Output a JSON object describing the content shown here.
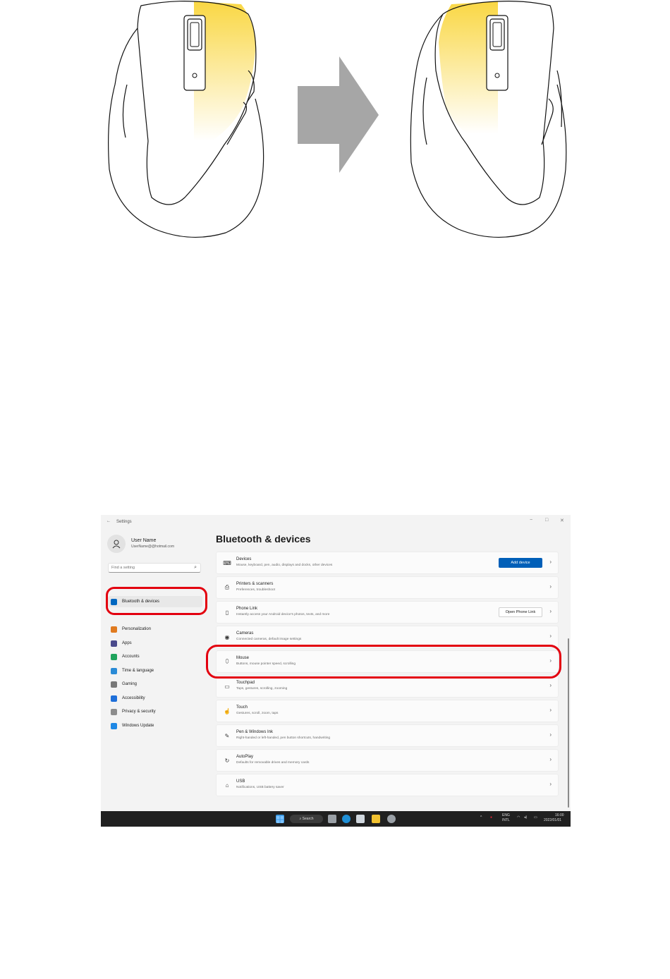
{
  "window": {
    "back_glyph": "←",
    "title": "Settings",
    "minimize_glyph": "−",
    "maximize_glyph": "□",
    "close_glyph": "✕"
  },
  "user": {
    "name": "User Name",
    "email": "UserName@@hotmail.com"
  },
  "search": {
    "placeholder": "Find a setting",
    "icon": "search-icon"
  },
  "sidebar": {
    "items": [
      {
        "label": "Bluetooth & devices",
        "icon": "bluetooth-icon",
        "color": "#0067c0",
        "active": true
      },
      {
        "label": "Personalization",
        "icon": "brush-icon",
        "color": "#e07a1f"
      },
      {
        "label": "Apps",
        "icon": "apps-icon",
        "color": "#4a4a8c"
      },
      {
        "label": "Accounts",
        "icon": "accounts-icon",
        "color": "#1fa35c"
      },
      {
        "label": "Time & language",
        "icon": "globe-clock-icon",
        "color": "#2a8bd6"
      },
      {
        "label": "Gaming",
        "icon": "gamepad-icon",
        "color": "#777777"
      },
      {
        "label": "Accessibility",
        "icon": "accessibility-icon",
        "color": "#1e6fd9"
      },
      {
        "label": "Privacy & security",
        "icon": "shield-icon",
        "color": "#8c8c8c"
      },
      {
        "label": "Windows Update",
        "icon": "update-icon",
        "color": "#1e88e5"
      }
    ]
  },
  "main": {
    "title": "Bluetooth & devices",
    "rows": [
      {
        "title": "Devices",
        "desc": "Mouse, keyboard, pen, audio, displays and docks, other devices",
        "icon": "devices-icon",
        "button": "Add device",
        "button_style": "primary"
      },
      {
        "title": "Printers & scanners",
        "desc": "Preferences, troubleshoot",
        "icon": "printer-icon"
      },
      {
        "title": "Phone Link",
        "desc": "Instantly access your Android device's photos, texts, and more",
        "icon": "phone-icon",
        "button": "Open Phone Link",
        "button_style": "secondary"
      },
      {
        "title": "Cameras",
        "desc": "Connected cameras, default image settings",
        "icon": "camera-icon"
      },
      {
        "title": "Mouse",
        "desc": "Buttons, mouse pointer speed, scrolling",
        "icon": "mouse-icon"
      },
      {
        "title": "Touchpad",
        "desc": "Taps, gestures, scrolling, zooming",
        "icon": "touchpad-icon"
      },
      {
        "title": "Touch",
        "desc": "Gestures, scroll, zoom, taps",
        "icon": "touch-icon"
      },
      {
        "title": "Pen & Windows Ink",
        "desc": "Right-handed or left-handed, pen button shortcuts, handwriting",
        "icon": "pen-icon"
      },
      {
        "title": "AutoPlay",
        "desc": "Defaults for removable drives and memory cards",
        "icon": "autoplay-icon"
      },
      {
        "title": "USB",
        "desc": "Notifications, USB battery saver",
        "icon": "usb-icon"
      }
    ]
  },
  "taskbar": {
    "search_label": "Search",
    "tray_language": "ENG",
    "tray_layout": "INTL",
    "time": "16:00",
    "date": "2022/01/01",
    "background": "#202020"
  },
  "colors": {
    "accent": "#005fb8",
    "highlight": "#e3000f",
    "glow": "#f9d53a",
    "arrow": "#a6a6a6"
  }
}
